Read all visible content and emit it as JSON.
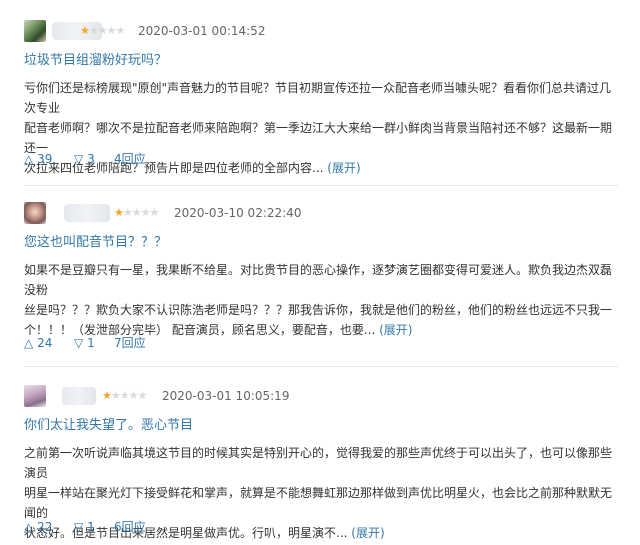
{
  "reviews": [
    {
      "time": "2020-03-01 00:14:52",
      "rating": 1,
      "title": "垃圾节目组溜粉好玩吗？",
      "content_line1": "亏你们还是标榜展现\"原创\"声音魅力的节目呢？节目初期宣传还拉一众配音老师当噱头呢？看看你们总共请过几次专业",
      "content_line2": "配音老师啊？哪次不是拉配音老师来陪跑啊？第一季边江大大来给一群小鲜肉当背景当陪衬还不够？这最新一期还一",
      "content_line3": "次拉来四位老师陪跑？预告片即是四位老师的全部内容...",
      "expand": "(展开)",
      "up_icon": "△",
      "up": "39",
      "down_icon": "▽",
      "down": "3",
      "replies": "4回应"
    },
    {
      "time": "2020-03-10 02:22:40",
      "rating": 1,
      "title": "您这也叫配音节目？？？",
      "content_line1": "如果不是豆瓣只有一星，我果断不给星。对比贵节目的恶心操作，逐梦演艺圈都变得可爱迷人。欺负我边杰双磊没粉",
      "content_line2": "丝是吗？？？欺负大家不认识陈浩老师是吗？？？那我告诉你，我就是他们的粉丝，他们的粉丝也远远不只我一",
      "content_line3": "个！！！（发泄部分完毕） 配音演员，顾名思义，要配音，也要...",
      "expand": "(展开)",
      "up_icon": "△",
      "up": "24",
      "down_icon": "▽",
      "down": "1",
      "replies": "7回应"
    },
    {
      "time": "2020-03-01 10:05:19",
      "rating": 1,
      "title": "你们太让我失望了。恶心节目",
      "content_line1": "之前第一次听说声临其境这节目的时候其实是特别开心的，觉得我爱的那些声优终于可以出头了，也可以像那些演员",
      "content_line2": "明星一样站在聚光灯下接受鲜花和掌声，就算是不能想舞虹那边那样做到声优比明星火，也会比之前那种默默无闻的",
      "content_line3": "状态好。但是节目出来居然是明星做声优。行叭，明星演不...",
      "expand": "(展开)",
      "up_icon": "△",
      "up": "22",
      "down_icon": "▽",
      "down": "1",
      "replies": "6回应"
    }
  ],
  "colors": {
    "link": "#3377aa",
    "star": "#f5a623",
    "text": "#333333",
    "meta": "#666666"
  },
  "icons": {
    "star_full": "★",
    "star_empty": "★"
  }
}
